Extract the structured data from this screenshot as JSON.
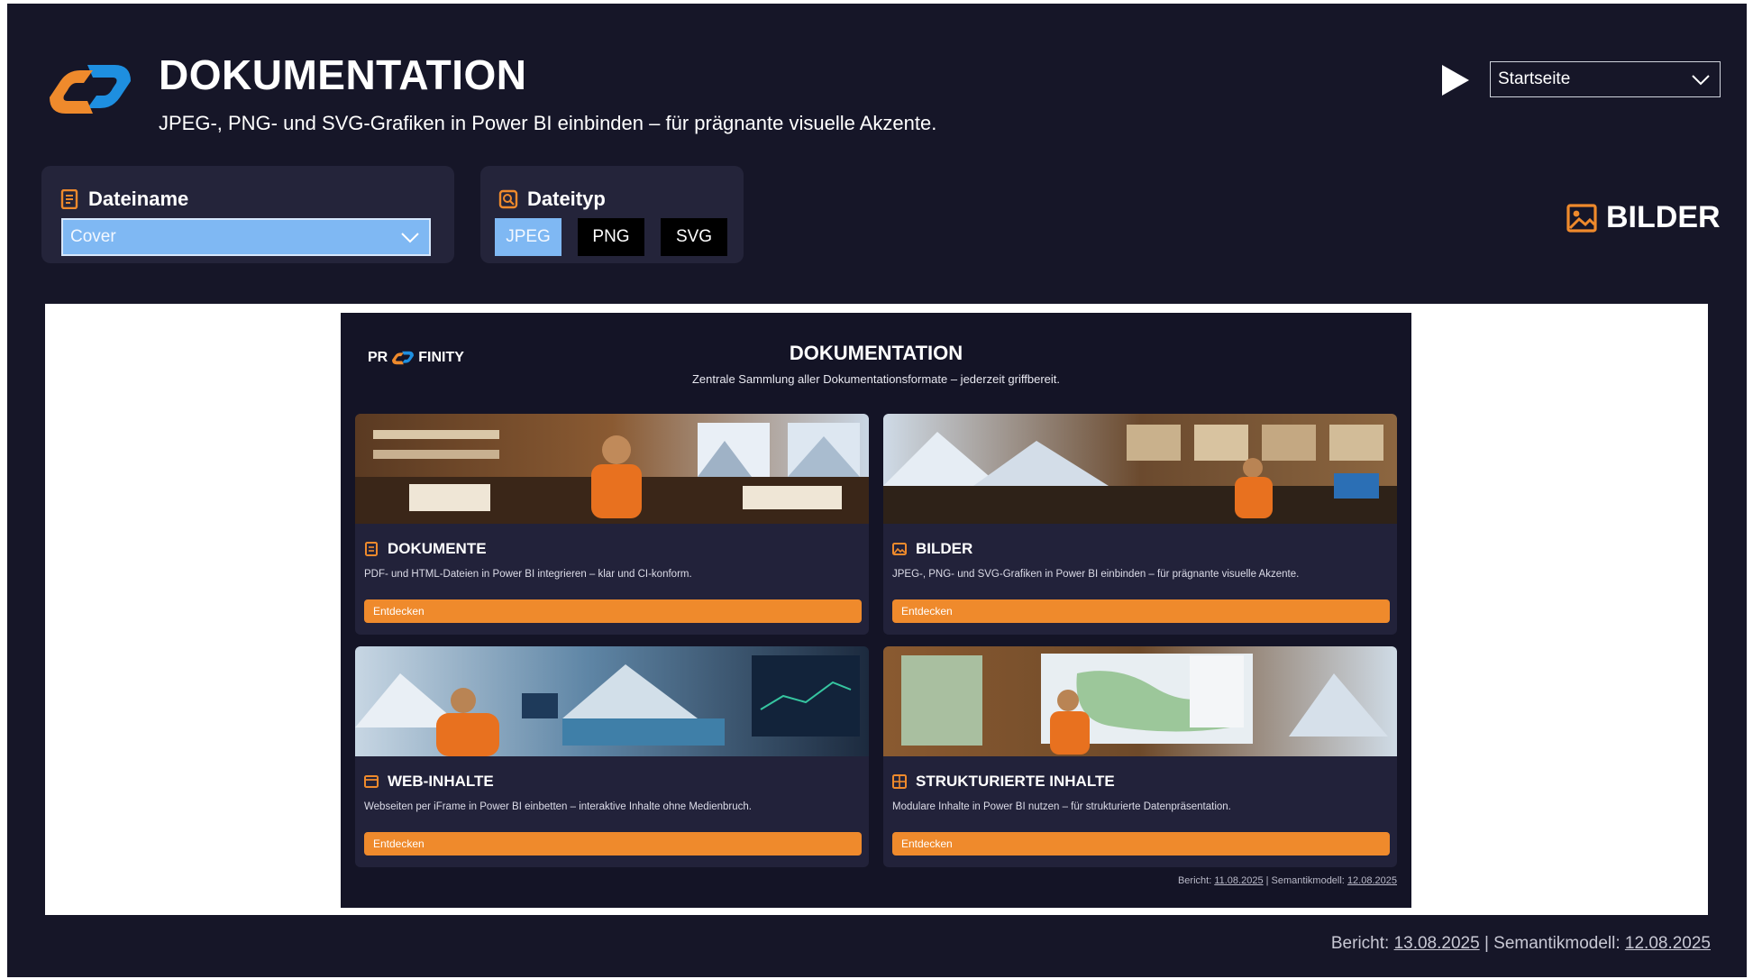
{
  "header": {
    "title": "DOKUMENTATION",
    "subtitle": "JPEG-, PNG- und SVG-Grafiken in Power BI einbinden – für prägnante visuelle Akzente.",
    "page_select_value": "Startseite"
  },
  "filters": {
    "filename": {
      "label": "Dateiname",
      "value": "Cover"
    },
    "filetype": {
      "label": "Dateityp",
      "options": [
        "JPEG",
        "PNG",
        "SVG"
      ],
      "selected": "JPEG"
    }
  },
  "section_label": "BILDER",
  "preview": {
    "brand_left": "PR",
    "brand_right": "FINITY",
    "title": "DOKUMENTATION",
    "subtitle": "Zentrale Sammlung aller Dokumentationsformate – jederzeit griffbereit.",
    "cards": [
      {
        "title": "DOKUMENTE",
        "description": "PDF- und HTML-Dateien in Power BI integrieren – klar und CI-konform.",
        "button": "Entdecken",
        "icon": "document-icon"
      },
      {
        "title": "BILDER",
        "description": "JPEG-, PNG- und SVG-Grafiken in Power BI einbinden – für prägnante visuelle Akzente.",
        "button": "Entdecken",
        "icon": "image-icon"
      },
      {
        "title": "WEB-INHALTE",
        "description": "Webseiten per iFrame in Power BI einbetten – interaktive Inhalte ohne Medienbruch.",
        "button": "Entdecken",
        "icon": "browser-icon"
      },
      {
        "title": "STRUKTURIERTE INHALTE",
        "description": "Modulare Inhalte in Power BI nutzen – für strukturierte Datenpräsentation.",
        "button": "Entdecken",
        "icon": "grid-icon"
      }
    ],
    "footer": {
      "report_label": "Bericht:",
      "report_date": "11.08.2025",
      "model_label": "| Semantikmodell:",
      "model_date": "12.08.2025"
    }
  },
  "footer": {
    "report_label": "Bericht:",
    "report_date": "13.08.2025",
    "model_label": "| Semantikmodell:",
    "model_date": "12.08.2025"
  },
  "colors": {
    "background": "#161628",
    "accent": "#ef8a2c",
    "selection": "#7fb8f3",
    "logo_blue": "#1e8fe0"
  }
}
